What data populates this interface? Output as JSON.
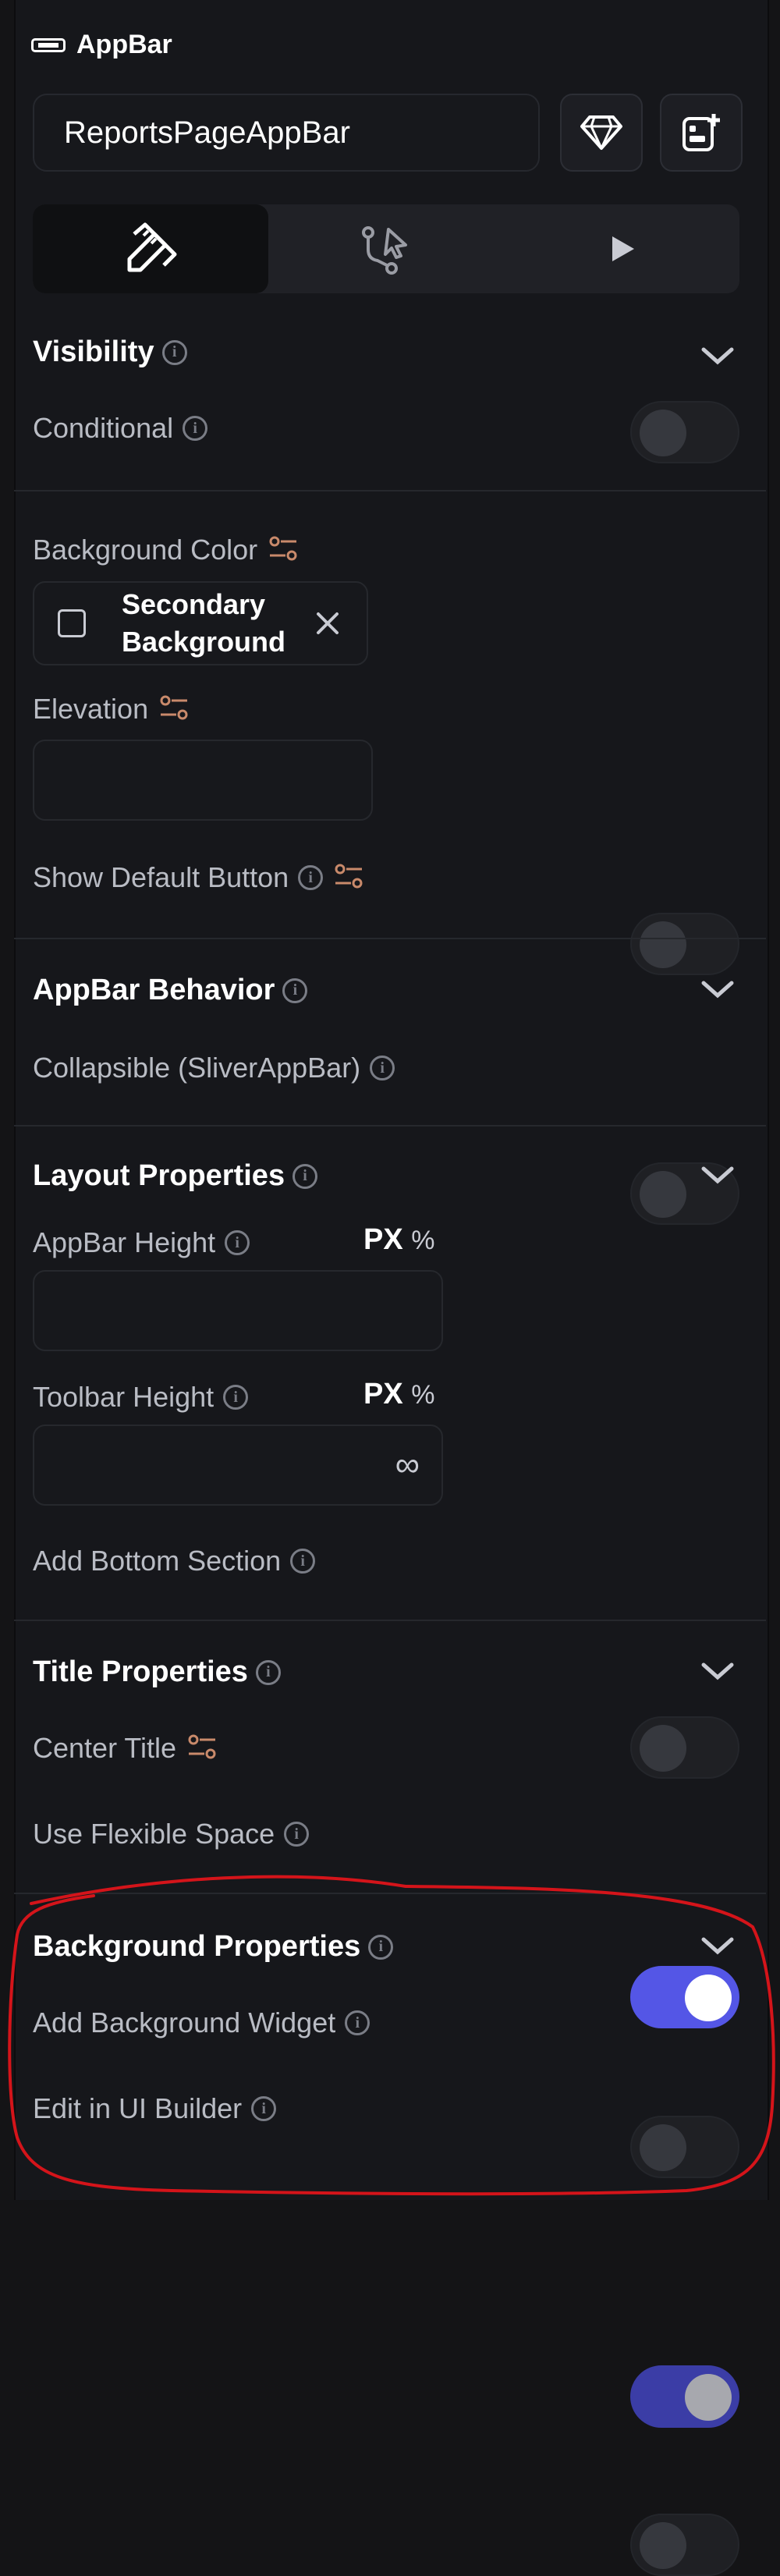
{
  "header": {
    "title": "AppBar",
    "widget_name": "ReportsPageAppBar"
  },
  "tabs": [
    {
      "icon": "properties-icon",
      "active": true
    },
    {
      "icon": "actions-flow-icon",
      "active": false
    },
    {
      "icon": "play-icon",
      "active": false
    }
  ],
  "visibility": {
    "title": "Visibility",
    "conditional_label": "Conditional",
    "conditional_on": false
  },
  "background": {
    "color_label": "Background Color",
    "color_value_line1": "Secondary",
    "color_value_line2": "Background",
    "elevation_label": "Elevation",
    "elevation_value": "",
    "show_default_button_label": "Show Default Button",
    "show_default_button_on": false
  },
  "behavior": {
    "title": "AppBar Behavior",
    "collapsible_label": "Collapsible (SliverAppBar)",
    "collapsible_on": false
  },
  "layout": {
    "title": "Layout Properties",
    "appbar_height_label": "AppBar Height",
    "appbar_height_value": "",
    "toolbar_height_label": "Toolbar Height",
    "toolbar_height_value": "∞",
    "unit_px": "PX",
    "unit_pct": "%",
    "add_bottom_section_label": "Add Bottom Section",
    "add_bottom_section_on": false
  },
  "title_props": {
    "title": "Title Properties",
    "center_title_label": "Center Title",
    "center_title_on": true,
    "flexible_space_label": "Use Flexible Space",
    "flexible_space_on": false
  },
  "bg_props": {
    "title": "Background Properties",
    "add_bg_widget_label": "Add Background Widget",
    "add_bg_widget_on": true,
    "edit_in_ui_builder_label": "Edit in UI Builder",
    "edit_in_ui_builder_on": false
  },
  "colors": {
    "accent": "#5456e6",
    "binding": "#c98a6b",
    "annotation": "#d4141a"
  }
}
